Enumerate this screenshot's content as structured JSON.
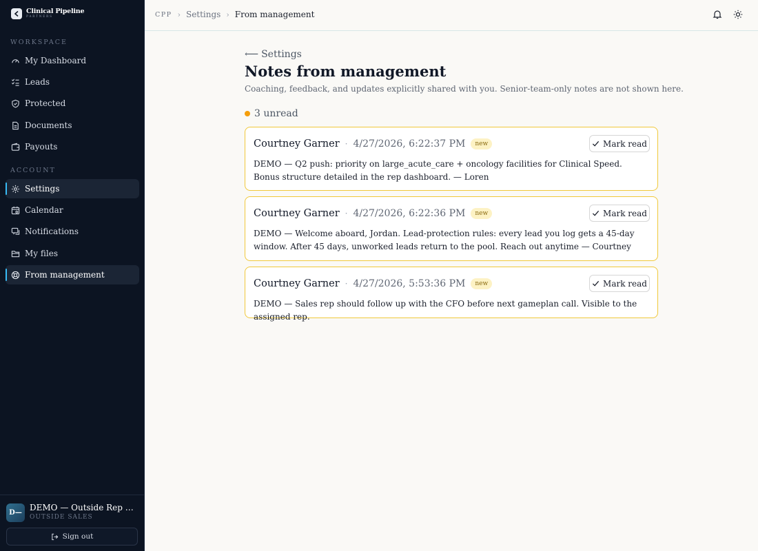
{
  "brand": {
    "name": "Clinical Pipeline",
    "sub": "PARTNERS"
  },
  "sidebar": {
    "workspace_label": "WORKSPACE",
    "account_label": "ACCOUNT",
    "workspace_items": [
      {
        "label": "My Dashboard",
        "icon": "gauge-icon"
      },
      {
        "label": "Leads",
        "icon": "checklist-icon"
      },
      {
        "label": "Protected",
        "icon": "shield-icon"
      },
      {
        "label": "Documents",
        "icon": "document-icon"
      },
      {
        "label": "Payouts",
        "icon": "wallet-icon"
      }
    ],
    "account_items": [
      {
        "label": "Settings",
        "icon": "gear-icon"
      },
      {
        "label": "Calendar",
        "icon": "calendar-icon"
      },
      {
        "label": "Notifications",
        "icon": "message-icon"
      },
      {
        "label": "My files",
        "icon": "folder-icon"
      },
      {
        "label": "From management",
        "icon": "lifebuoy-icon"
      }
    ]
  },
  "user": {
    "initials": "D—",
    "name": "DEMO — Outside Rep — Jordan",
    "role": "OUTSIDE SALES",
    "signout_label": "Sign out"
  },
  "breadcrumb": {
    "root": "CPP",
    "parent": "Settings",
    "current": "From management"
  },
  "main": {
    "back_label": "Settings",
    "title": "Notes from management",
    "subtitle": "Coaching, feedback, and updates explicitly shared with you. Senior-team-only notes are not shown here.",
    "unread_label": "3 unread",
    "accent_color": "#f59e0b"
  },
  "notes": [
    {
      "author": "Courtney Garner",
      "timestamp": "4/27/2026, 6:22:37 PM",
      "badge": "new",
      "action": "Mark read",
      "body": "DEMO — Q2 push: priority on large_acute_care + oncology facilities for Clinical Speed. Bonus structure detailed in the rep dashboard. — Loren"
    },
    {
      "author": "Courtney Garner",
      "timestamp": "4/27/2026, 6:22:36 PM",
      "badge": "new",
      "action": "Mark read",
      "body": "DEMO — Welcome aboard, Jordan. Lead-protection rules: every lead you log gets a 45-day window. After 45 days, unworked leads return to the pool. Reach out anytime — Courtney"
    },
    {
      "author": "Courtney Garner",
      "timestamp": "4/27/2026, 5:53:36 PM",
      "badge": "new",
      "action": "Mark read",
      "body": "DEMO — Sales rep should follow up with the CFO before next gameplan call. Visible to the assigned rep."
    }
  ]
}
